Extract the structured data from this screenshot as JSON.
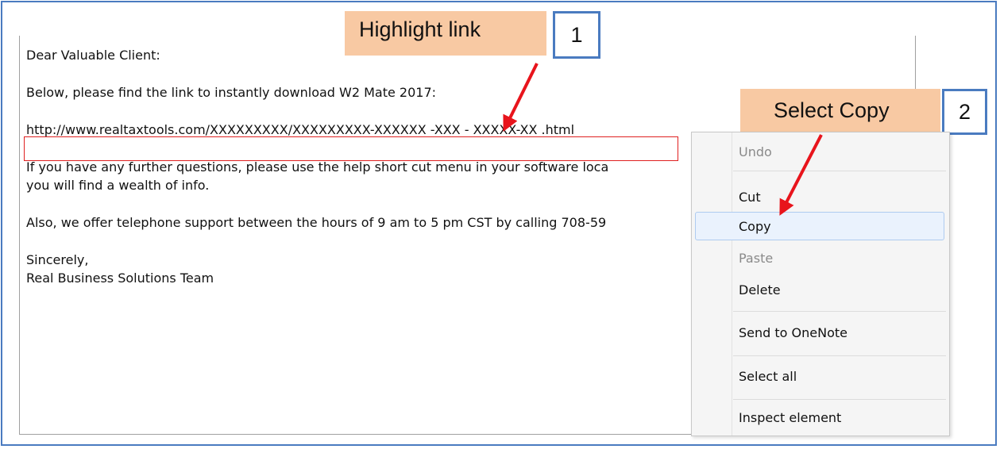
{
  "email": {
    "greeting": "Dear Valuable Client:",
    "intro": "Below, please find the link to instantly download W2 Mate 2017:",
    "link": "http://www.realtaxtools.com/XXXXXXXXX/XXXXXXXXX-XXXXXX -XXX - XXXXX-XX .html",
    "questions_line1": "If you have any further questions, please use the help short cut menu in your software loca",
    "questions_line2": "you will find a wealth of info.",
    "support": "Also, we offer telephone support between the hours of 9 am to 5 pm CST by calling 708-59",
    "closing": "Sincerely,",
    "signature": "Real Business Solutions Team"
  },
  "callouts": {
    "step1_label": "Highlight link",
    "step1_number": "1",
    "step2_label": "Select Copy",
    "step2_number": "2"
  },
  "context_menu": {
    "items": [
      {
        "label": "Undo",
        "enabled": false
      },
      {
        "label": "Cut",
        "enabled": true
      },
      {
        "label": "Copy",
        "enabled": true,
        "highlighted": true
      },
      {
        "label": "Paste",
        "enabled": false
      },
      {
        "label": "Delete",
        "enabled": true
      },
      {
        "label": "Send to OneNote",
        "enabled": true
      },
      {
        "label": "Select all",
        "enabled": true
      },
      {
        "label": "Inspect element",
        "enabled": true
      }
    ]
  },
  "colors": {
    "frame_blue": "#4a7bc0",
    "callout_peach": "#f8c9a3",
    "arrow_red": "#e8141c",
    "link_border_red": "#e02020"
  }
}
